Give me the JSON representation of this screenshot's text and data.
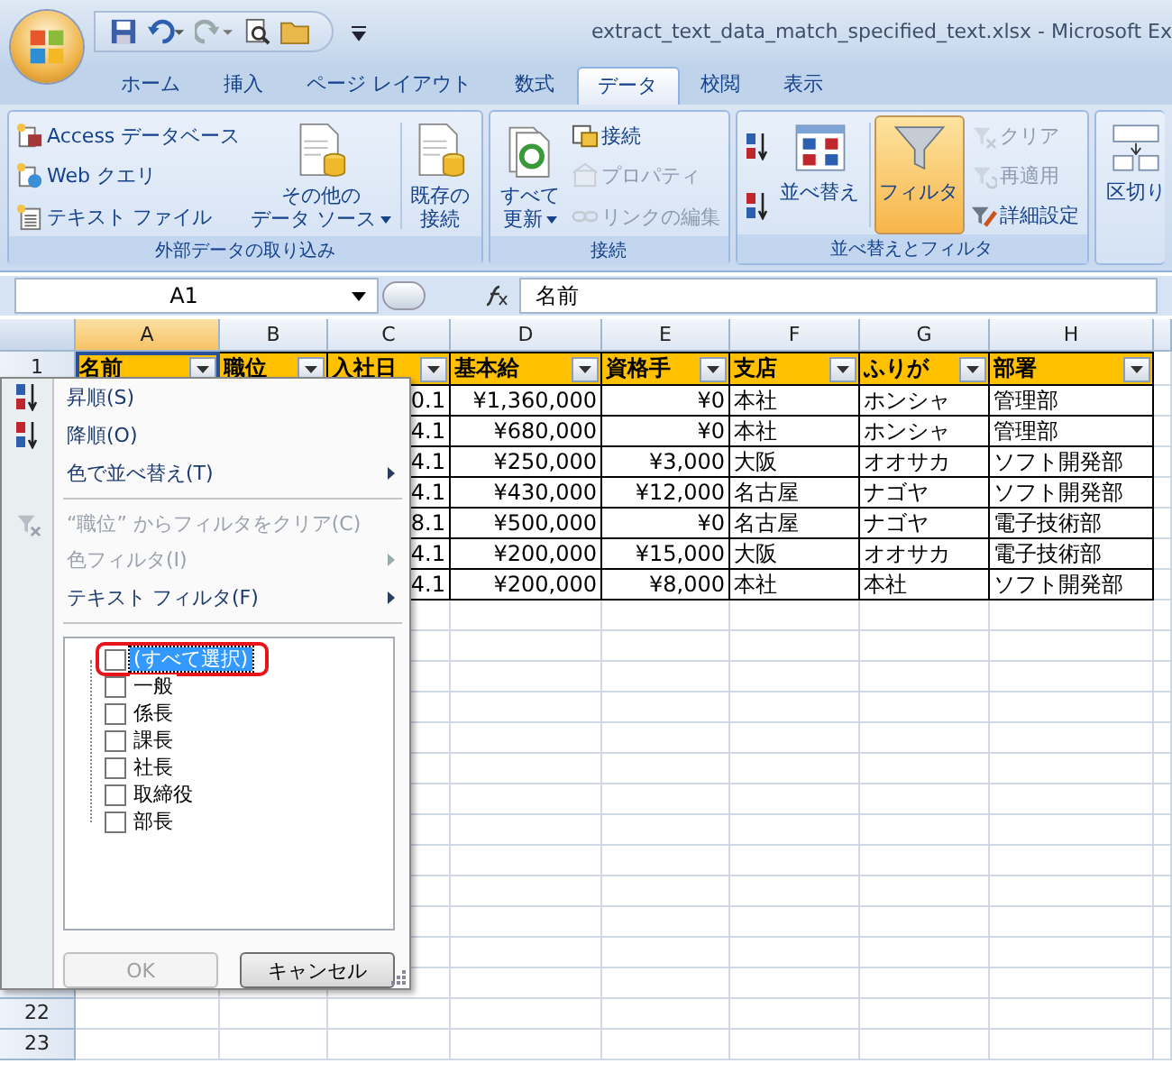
{
  "window": {
    "title": "extract_text_data_match_specified_text.xlsx - Microsoft Ex"
  },
  "ribbon_tabs": [
    {
      "label": "ホーム",
      "selected": false
    },
    {
      "label": "挿入",
      "selected": false
    },
    {
      "label": "ページ レイアウト",
      "selected": false
    },
    {
      "label": "数式",
      "selected": false
    },
    {
      "label": "データ",
      "selected": true
    },
    {
      "label": "校閲",
      "selected": false
    },
    {
      "label": "表示",
      "selected": false
    }
  ],
  "ribbon_groups": [
    {
      "title": "外部データの取り込み",
      "items": [
        {
          "kind": "stack",
          "children": [
            {
              "label": "Access データベース",
              "disabled": false
            },
            {
              "label": "Web クエリ",
              "disabled": false
            },
            {
              "label": "テキスト ファイル",
              "disabled": false
            }
          ]
        },
        {
          "kind": "large",
          "lines": [
            "その他の",
            "データ ソース"
          ],
          "dropdown": true,
          "selected": false
        },
        {
          "kind": "divider"
        },
        {
          "kind": "large",
          "lines": [
            "既存の",
            "接続"
          ],
          "dropdown": false,
          "selected": false
        }
      ]
    },
    {
      "title": "接続",
      "items": [
        {
          "kind": "large",
          "lines": [
            "すべて",
            "更新"
          ],
          "dropdown": true,
          "selected": false
        },
        {
          "kind": "stack",
          "children": [
            {
              "label": "接続",
              "disabled": false
            },
            {
              "label": "プロパティ",
              "disabled": true
            },
            {
              "label": "リンクの編集",
              "disabled": true
            }
          ]
        }
      ]
    },
    {
      "title": "並べ替えとフィルタ",
      "items": [
        {
          "kind": "stack",
          "children": [
            {
              "disabled": false
            },
            {
              "disabled": false
            }
          ]
        },
        {
          "kind": "large",
          "lines": [
            "並べ替え"
          ],
          "dropdown": false,
          "selected": false
        },
        {
          "kind": "divider"
        },
        {
          "kind": "large",
          "lines": [
            "フィルタ"
          ],
          "dropdown": false,
          "selected": true
        },
        {
          "kind": "stack",
          "children": [
            {
              "label": "クリア",
              "disabled": true
            },
            {
              "label": "再適用",
              "disabled": true
            },
            {
              "label": "詳細設定",
              "disabled": false
            }
          ]
        }
      ]
    },
    {
      "items": [
        {
          "kind": "large",
          "lines": [
            "区切り"
          ],
          "dropdown": false,
          "selected": false
        }
      ]
    }
  ],
  "formula_bar": {
    "name_box": "A1",
    "formula": "名前"
  },
  "sheet": {
    "columns": [
      {
        "label": "A",
        "selected": true
      },
      {
        "label": "B",
        "selected": false
      },
      {
        "label": "C",
        "selected": false
      },
      {
        "label": "D",
        "selected": false
      },
      {
        "label": "E",
        "selected": false
      },
      {
        "label": "F",
        "selected": false
      },
      {
        "label": "G",
        "selected": false
      },
      {
        "label": "H",
        "selected": false
      }
    ],
    "header_row_number": "1",
    "headers": [
      "名前",
      "職位",
      "入社日",
      "基本給",
      "資格手",
      "支店",
      "ふりが",
      "部署"
    ],
    "rows": [
      [
        "",
        "",
        "0.1",
        "¥1,360,000",
        "¥0",
        "本社",
        "ホンシャ",
        "管理部"
      ],
      [
        "",
        "",
        "4.1",
        "¥680,000",
        "¥0",
        "本社",
        "ホンシャ",
        "管理部"
      ],
      [
        "",
        "",
        "4.1",
        "¥250,000",
        "¥3,000",
        "大阪",
        "オオサカ",
        "ソフト開発部"
      ],
      [
        "",
        "",
        "4.1",
        "¥430,000",
        "¥12,000",
        "名古屋",
        "ナゴヤ",
        "ソフト開発部"
      ],
      [
        "",
        "",
        "8.1",
        "¥500,000",
        "¥0",
        "名古屋",
        "ナゴヤ",
        "電子技術部"
      ],
      [
        "",
        "",
        "4.1",
        "¥200,000",
        "¥15,000",
        "大阪",
        "オオサカ",
        "電子技術部"
      ],
      [
        "",
        "",
        "4.1",
        "¥200,000",
        "¥8,000",
        "本社",
        "本社",
        "ソフト開発部"
      ]
    ],
    "bottom_row_numbers": [
      "22",
      "23"
    ]
  },
  "filter_menu": {
    "items": [
      {
        "kind": "command",
        "label": "昇順(S)",
        "disabled": false,
        "submenu": false
      },
      {
        "kind": "command",
        "label": "降順(O)",
        "disabled": false,
        "submenu": false
      },
      {
        "kind": "command",
        "label": "色で並べ替え(T)",
        "disabled": false,
        "submenu": true
      },
      {
        "kind": "separator"
      },
      {
        "kind": "command",
        "label": "“職位” からフィルタをクリア(C)",
        "disabled": true,
        "submenu": false
      },
      {
        "kind": "command",
        "label": "色フィルタ(I)",
        "disabled": true,
        "submenu": true
      },
      {
        "kind": "command",
        "label": "テキスト フィルタ(F)",
        "disabled": false,
        "submenu": true
      },
      {
        "kind": "separator"
      }
    ],
    "values": [
      {
        "label": "(すべて選択)",
        "checked": false,
        "selected": true,
        "annotated": true
      },
      {
        "label": "一般",
        "checked": false,
        "selected": false,
        "annotated": false
      },
      {
        "label": "係長",
        "checked": false,
        "selected": false,
        "annotated": false
      },
      {
        "label": "課長",
        "checked": false,
        "selected": false,
        "annotated": false
      },
      {
        "label": "社長",
        "checked": false,
        "selected": false,
        "annotated": false
      },
      {
        "label": "取締役",
        "checked": false,
        "selected": false,
        "annotated": false
      },
      {
        "label": "部長",
        "checked": false,
        "selected": false,
        "annotated": false
      }
    ],
    "buttons": [
      {
        "label": "OK",
        "disabled": true
      },
      {
        "label": "キャンセル",
        "disabled": false
      }
    ]
  }
}
